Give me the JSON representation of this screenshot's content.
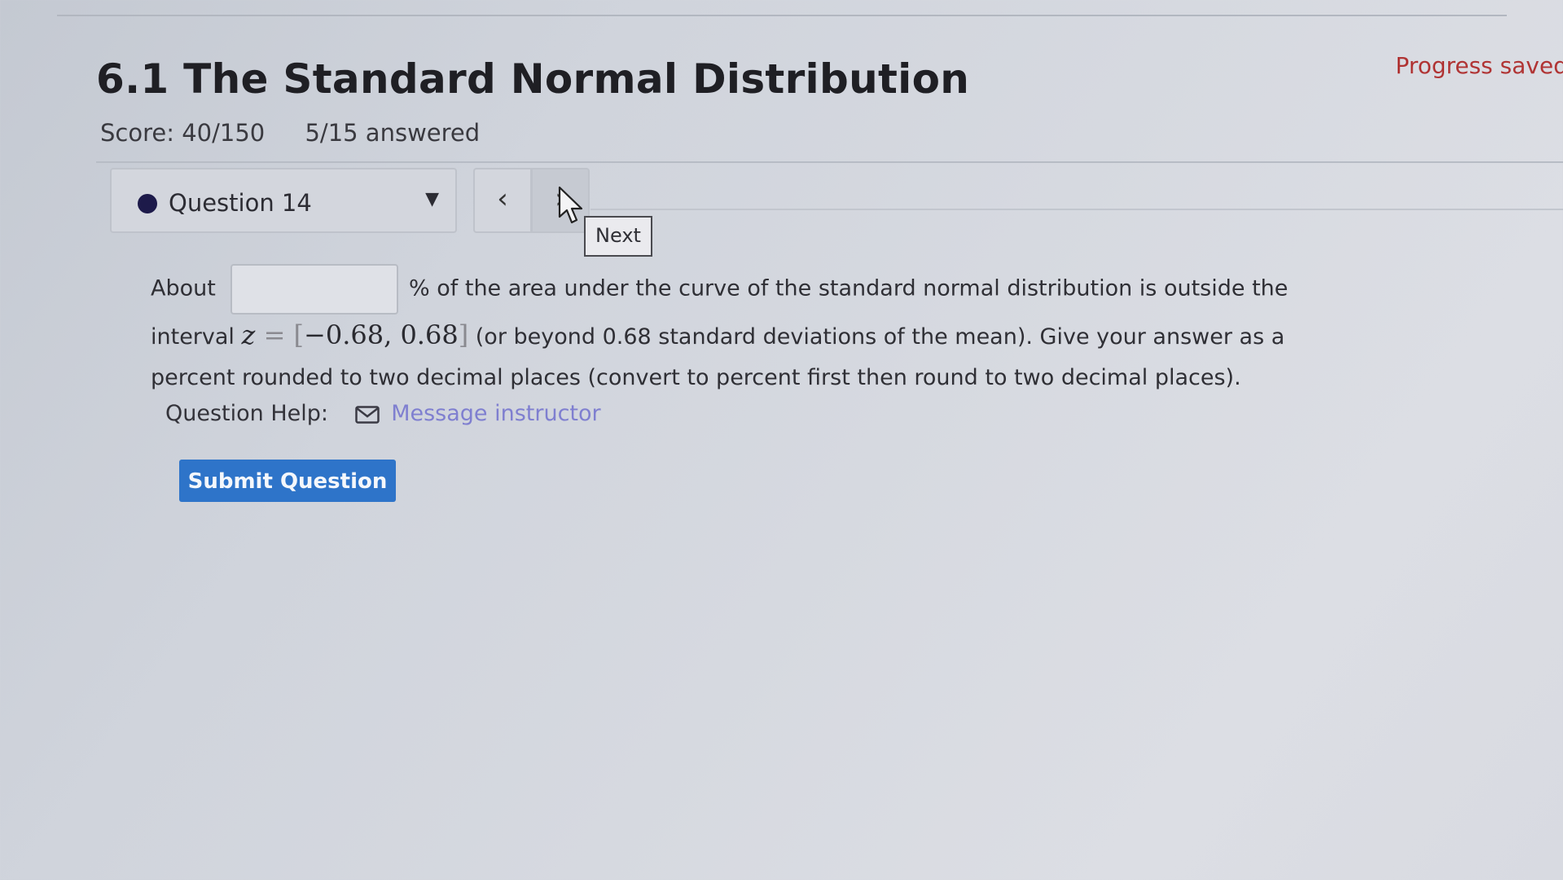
{
  "header": {
    "title": "6.1 The Standard Normal Distribution",
    "progress_status": "Progress saved",
    "score": "Score: 40/150",
    "answered": "5/15 answered"
  },
  "navigation": {
    "question_label": "Question 14",
    "prev_symbol": "‹",
    "next_symbol": "›",
    "next_tooltip": "Next"
  },
  "question": {
    "prefix": "About",
    "answer_value": "",
    "after_input": "% of the area under the curve of the standard normal distribution is outside the",
    "interval_prefix": "interval",
    "math_var": "z",
    "math_equals": " = ",
    "math_open": "[",
    "math_interval": "−0.68, 0.68",
    "math_close": "]",
    "interval_suffix": "(or beyond 0.68 standard deviations of the mean). Give your answer as a",
    "line3": "percent rounded to two decimal places (convert to percent first then round to two decimal places)."
  },
  "help": {
    "label": "Question Help:",
    "icon": "mail-icon",
    "link_text": "Message instructor"
  },
  "actions": {
    "submit_label": "Submit Question"
  },
  "colors": {
    "accent_button": "#2e74c9",
    "link": "#7f7fd0",
    "progress_saved": "#b03434",
    "question_dot": "#1d1a4a"
  }
}
